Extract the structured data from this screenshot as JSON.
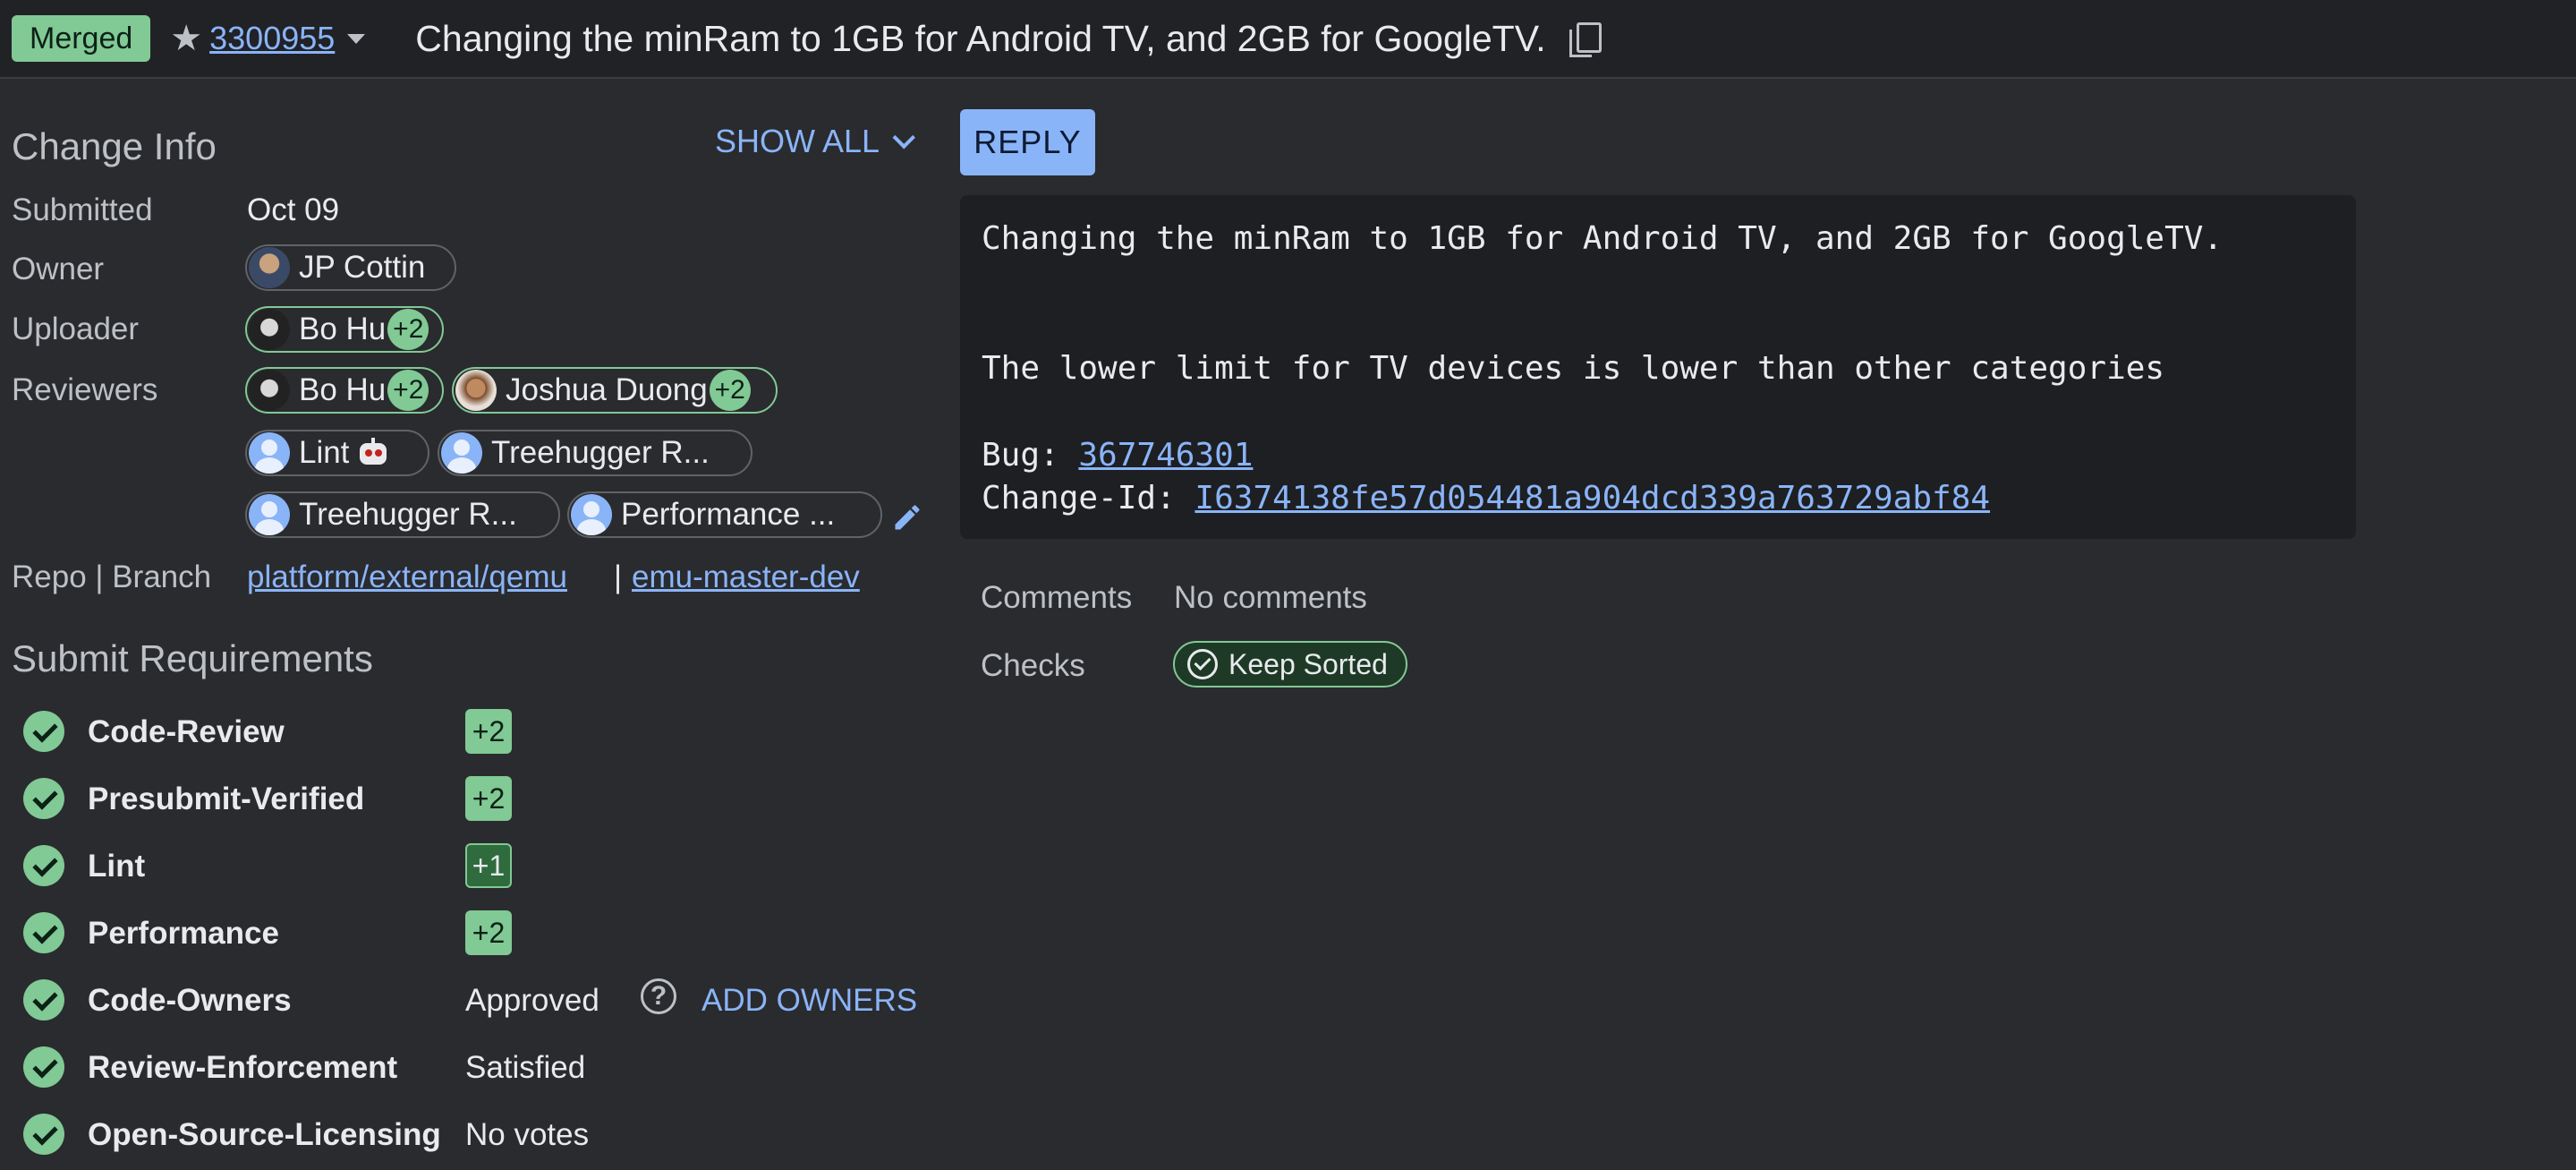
{
  "header": {
    "status": "Merged",
    "change_number": "3300955",
    "subject": "Changing the minRam to 1GB for Android TV, and 2GB for GoogleTV."
  },
  "change_info": {
    "title": "Change Info",
    "show_all": "SHOW ALL",
    "submitted_label": "Submitted",
    "submitted_value": "Oct 09",
    "owner_label": "Owner",
    "owner_name": "JP Cottin",
    "uploader_label": "Uploader",
    "uploader_name": "Bo Hu",
    "uploader_vote": "+2",
    "reviewers_label": "Reviewers",
    "reviewers": [
      {
        "name": "Bo Hu",
        "vote": "+2"
      },
      {
        "name": "Joshua Duong",
        "vote": "+2"
      },
      {
        "name": "Lint"
      },
      {
        "name": "Treehugger R..."
      },
      {
        "name": "Treehugger R..."
      },
      {
        "name": "Performance ..."
      }
    ],
    "repo_label": "Repo | Branch",
    "repo": "platform/external/qemu",
    "separator": "|",
    "branch": "emu-master-dev"
  },
  "submit_requirements": {
    "title": "Submit Requirements",
    "items": [
      {
        "name": "Code-Review",
        "vote": "+2"
      },
      {
        "name": "Presubmit-Verified",
        "vote": "+2"
      },
      {
        "name": "Lint",
        "vote": "+1"
      },
      {
        "name": "Performance",
        "vote": "+2"
      },
      {
        "name": "Code-Owners",
        "status": "Approved",
        "help": "?",
        "action": "ADD OWNERS"
      },
      {
        "name": "Review-Enforcement",
        "status": "Satisfied"
      },
      {
        "name": "Open-Source-Licensing",
        "status": "No votes"
      }
    ]
  },
  "reply_button": "REPLY",
  "commit_message": {
    "line1": "Changing the minRam to 1GB for Android TV, and 2GB for GoogleTV.",
    "line2": "The lower limit for TV devices is lower than other categories",
    "bug_label": "Bug: ",
    "bug_id": "367746301",
    "change_id_label": "Change-Id: ",
    "change_id": "I6374138fe57d054481a904dcd339a763729abf84"
  },
  "comments_label": "Comments",
  "comments_value": "No comments",
  "checks_label": "Checks",
  "checks_value": "Keep Sorted",
  "colors": {
    "background": "#2a2b2e",
    "accent_blue": "#8ab4f8",
    "approved_green": "#81c995"
  },
  "icons": [
    "star-icon",
    "chevron-down-icon",
    "copy-icon",
    "pencil-icon",
    "check-circle-icon",
    "help-icon",
    "robot-icon"
  ]
}
